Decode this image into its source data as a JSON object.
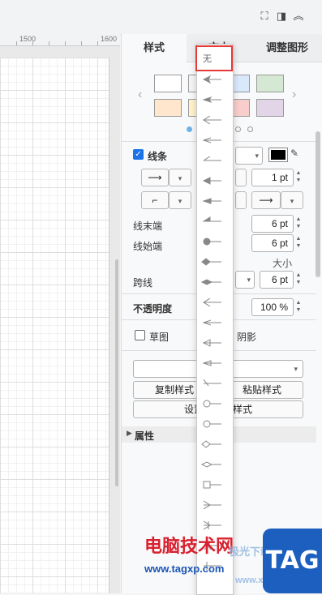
{
  "toolbar": {
    "icons": [
      "fullscreen-icon",
      "format-panel-icon",
      "collapse-icon"
    ]
  },
  "ruler": {
    "labels": [
      "1500",
      "1600"
    ]
  },
  "panel": {
    "tabs": [
      {
        "label": "样式",
        "active": true
      },
      {
        "label": "文本",
        "active": false
      },
      {
        "label": "调整图形",
        "active": false
      }
    ],
    "swatches_row1": [
      "#ffffff",
      "#f5f5f5",
      "#dae8fc",
      "#d5e8d4"
    ],
    "swatches_row2": [
      "#ffe6cc",
      "#fff2cc",
      "#f8cecc",
      "#e1d5e7"
    ],
    "line_label": "线条",
    "line_width": "1 pt",
    "line_end_label": "线末端",
    "line_end_size": "6 pt",
    "line_start_label": "线始端",
    "line_start_size": "6 pt",
    "size_label": "大小",
    "jump_label": "跨线",
    "jump_size": "6 pt",
    "opacity_label": "不透明度",
    "opacity_value": "100 %",
    "sketch_label": "草图",
    "shadow_label": "阴影",
    "copy_style": "复制样式",
    "paste_style": "粘贴样式",
    "set_default": "设置为默认样式",
    "properties": "属性",
    "line_color": "#000000"
  },
  "menu": {
    "none_label": "无",
    "items": [
      "classic",
      "classic-thin",
      "open",
      "open-thin",
      "open-async",
      "block",
      "block-thin",
      "async",
      "oval",
      "diamond",
      "diamond-thin",
      "classic-alt",
      "classic-thin-alt",
      "open-alt",
      "open-thin-alt",
      "dash",
      "half-circle",
      "oval-open",
      "diamond-open",
      "diamond-thin-open",
      "box",
      "ER-one",
      "ER-mandatory",
      "cross",
      "line"
    ]
  },
  "watermark": {
    "site_cn": "电脑技术网",
    "site_url": "www.tagxp.com",
    "logo": "TAG",
    "brand2": "极光下载站",
    "brand2_url": "www.xz7.com"
  }
}
